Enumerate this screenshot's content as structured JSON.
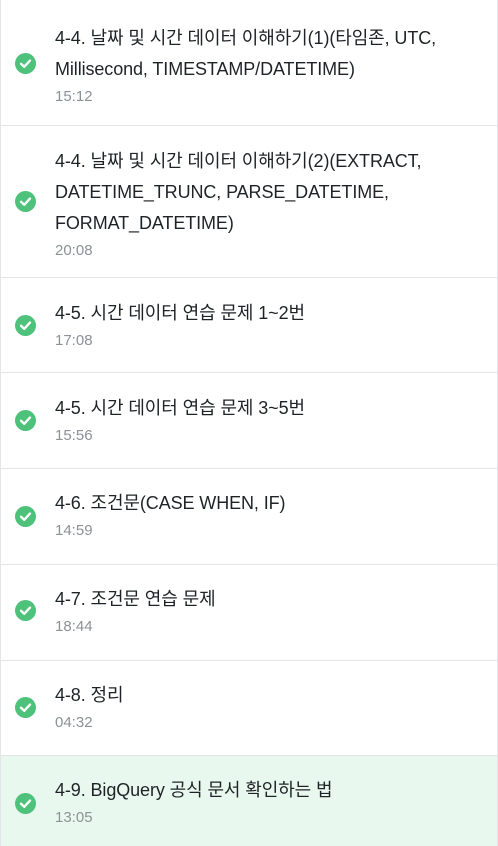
{
  "colors": {
    "check": "#4ec27a",
    "active_background": "#e9f8ef",
    "title_text": "#1f2327",
    "duration_text": "#8c9196",
    "divider": "#e3e5e8"
  },
  "lessons": [
    {
      "title_lines": [
        "4-4. 날짜 및 시간 데이터 이해하기(1)(타임존, UTC,",
        "Millisecond, TIMESTAMP/DATETIME)"
      ],
      "duration": "15:12",
      "status_icon": "check-circle-icon"
    },
    {
      "title_lines": [
        "4-4. 날짜 및 시간 데이터 이해하기(2)(EXTRACT,",
        "DATETIME_TRUNC, PARSE_DATETIME,",
        "FORMAT_DATETIME)"
      ],
      "duration": "20:08",
      "status_icon": "check-circle-icon"
    },
    {
      "title_lines": [
        "4-5. 시간 데이터 연습 문제 1~2번"
      ],
      "duration": "17:08",
      "status_icon": "check-circle-icon"
    },
    {
      "title_lines": [
        "4-5. 시간 데이터 연습 문제 3~5번"
      ],
      "duration": "15:56",
      "status_icon": "check-circle-icon"
    },
    {
      "title_lines": [
        "4-6. 조건문(CASE WHEN, IF)"
      ],
      "duration": "14:59",
      "status_icon": "check-circle-icon"
    },
    {
      "title_lines": [
        "4-7. 조건문 연습 문제"
      ],
      "duration": "18:44",
      "status_icon": "check-circle-icon"
    },
    {
      "title_lines": [
        "4-8. 정리"
      ],
      "duration": "04:32",
      "status_icon": "check-circle-icon"
    },
    {
      "title_lines": [
        "4-9. BigQuery 공식 문서 확인하는 법"
      ],
      "duration": "13:05",
      "status_icon": "check-circle-icon",
      "active": true
    }
  ]
}
